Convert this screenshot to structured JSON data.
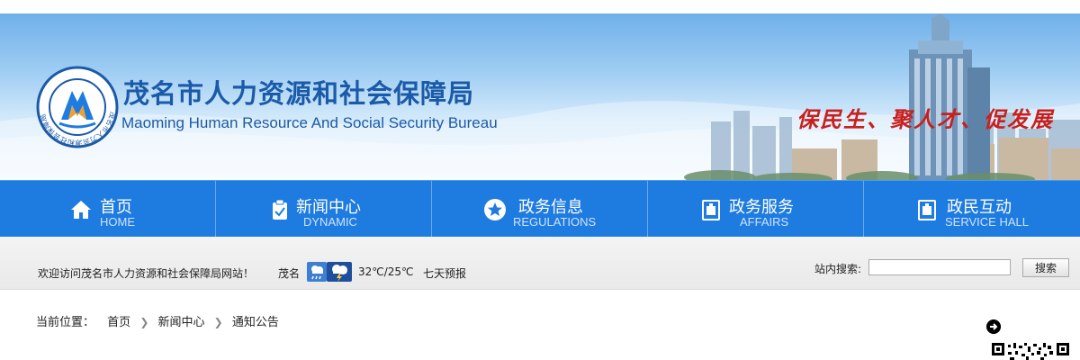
{
  "header": {
    "title_cn": "茂名市人力资源和社会保障局",
    "title_en": "Maoming Human Resource And Social Security Bureau",
    "slogan": "保民生、聚人才、促发展",
    "emblem_ring_text": "茂名市人力资源和社会保障局"
  },
  "nav": {
    "items": [
      {
        "label": "首页",
        "sub": "HOME",
        "icon": "home-icon"
      },
      {
        "label": "新闻中心",
        "sub": "DYNAMIC",
        "icon": "clipboard-icon"
      },
      {
        "label": "政务信息",
        "sub": "REGULATIONS",
        "icon": "star-icon"
      },
      {
        "label": "政务服务",
        "sub": "AFFAIRS",
        "icon": "document-icon"
      },
      {
        "label": "政民互动",
        "sub": "SERVICE HALL",
        "icon": "document-icon"
      }
    ]
  },
  "infobar": {
    "welcome": "欢迎访问茂名市人力资源和社会保障局网站！",
    "city": "茂名",
    "temperature": "32℃/25℃",
    "forecast_link": "七天预报",
    "weather_icons": [
      "shower-icon",
      "thunderstorm-icon"
    ]
  },
  "search": {
    "label": "站内搜索:",
    "value": "",
    "button": "搜索"
  },
  "breadcrumb": {
    "label": "当前位置：",
    "items": [
      "首页",
      "新闻中心",
      "通知公告"
    ]
  },
  "colors": {
    "nav_blue": "#1e7be0",
    "title_blue": "#1a5aa8",
    "slogan_red": "#c8201e"
  }
}
